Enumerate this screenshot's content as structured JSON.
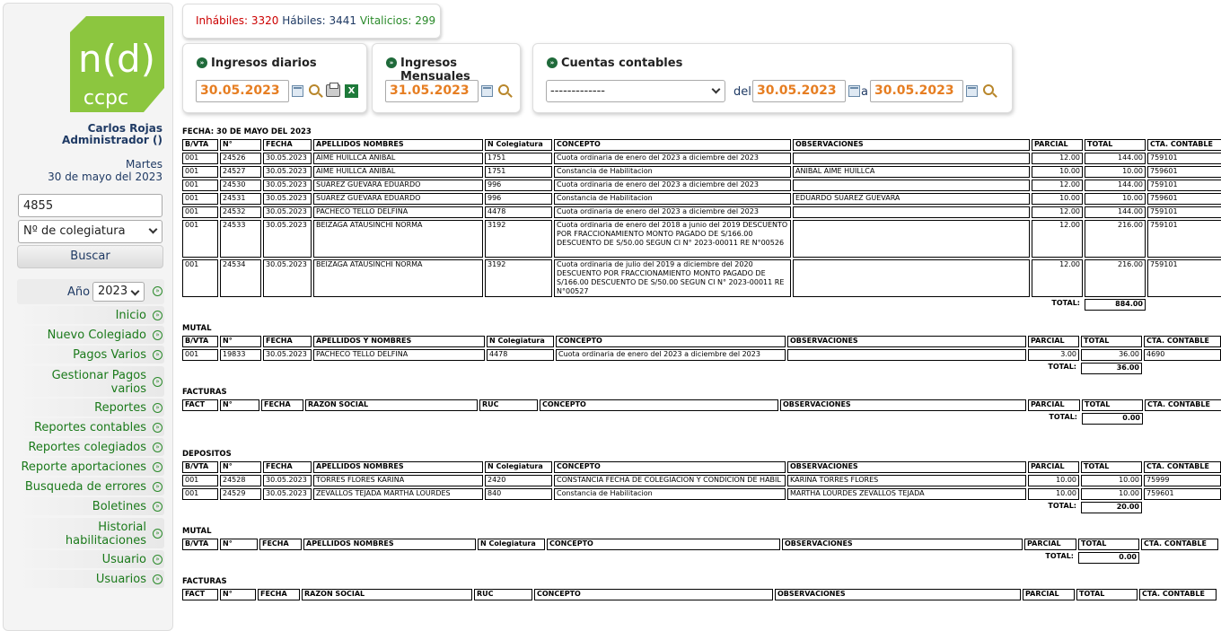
{
  "sidebar": {
    "logo_text_top": "n(d)",
    "logo_text_bottom": "ccpc",
    "user_name": "Carlos Rojas",
    "user_role": "Administrador ()",
    "weekday": "Martes",
    "date": "30 de mayo del 2023",
    "search_value": "4855",
    "search_type": "Nº de colegiatura",
    "search_button": "Buscar",
    "year_label": "Año",
    "year_value": "2023",
    "menu": [
      "Inicio",
      "Nuevo Colegiado",
      "Pagos Varios",
      "Gestionar Pagos varios",
      "Reportes",
      "Reportes contables",
      "Reportes colegiados",
      "Reporte aportaciones",
      "Busqueda de errores",
      "Boletines",
      "Historial habilitaciones",
      "Usuario",
      "Usuarios"
    ]
  },
  "counts": {
    "inhabiles_label": "Inhábiles:",
    "inhabiles": "3320",
    "habiles_label": "Hábiles:",
    "habiles": "3441",
    "vitalicios_label": "Vitalicios:",
    "vitalicios": "299"
  },
  "panels": {
    "diarios_title": "Ingresos diarios",
    "diarios_date": "30.05.2023",
    "mensuales_title": "Ingresos Mensuales",
    "mensuales_date": "31.05.2023",
    "cuentas_title": "Cuentas contables",
    "cuentas_select": "-------------",
    "del_label": "del:",
    "del_date": "30.05.2023",
    "a_label": "a",
    "a_date": "30.05.2023"
  },
  "report": {
    "fecha_title": "FECHA: 30 DE MAYO DEL 2023",
    "main_headers": [
      "B/VTA",
      "N°",
      "FECHA",
      "APELLIDOS NOMBRES",
      "N Colegiatura",
      "CONCEPTO",
      "OBSERVACIONES",
      "PARCIAL",
      "TOTAL",
      "CTA. CONTABLE"
    ],
    "main_rows": [
      [
        "001",
        "24526",
        "30.05.2023",
        "AIME HUILLCA ANIBAL",
        "1751",
        "Cuota ordinaria de enero del 2023 a diciembre del 2023",
        "",
        "12.00",
        "144.00",
        "759101"
      ],
      [
        "001",
        "24527",
        "30.05.2023",
        "AIME HUILLCA ANIBAL",
        "1751",
        "Constancia de Habilitacion",
        "ANIBAL AIME HUILLCA",
        "10.00",
        "10.00",
        "759601"
      ],
      [
        "001",
        "24530",
        "30.05.2023",
        "SUAREZ GUEVARA EDUARDO",
        "996",
        "Cuota ordinaria de enero del 2023 a diciembre del 2023",
        "",
        "12.00",
        "144.00",
        "759101"
      ],
      [
        "001",
        "24531",
        "30.05.2023",
        "SUAREZ GUEVARA EDUARDO",
        "996",
        "Constancia de Habilitacion",
        "EDUARDO SUAREZ GUEVARA",
        "10.00",
        "10.00",
        "759601"
      ],
      [
        "001",
        "24532",
        "30.05.2023",
        "PACHECO TELLO DELFINA",
        "4478",
        "Cuota ordinaria de enero del 2023 a diciembre del 2023",
        "",
        "12.00",
        "144.00",
        "759101"
      ],
      [
        "001",
        "24533",
        "30.05.2023",
        "BEIZAGA ATAUSINCHI NORMA",
        "3192",
        "Cuota ordinaria de enero del 2018 a junio del 2019 DESCUENTO POR FRACCIONAMIENTO MONTO PAGADO DE S/166.00 DESCUENTO DE S/50.00 SEGUN CI N° 2023-00011 RE N°00526",
        "",
        "12.00",
        "216.00",
        "759101"
      ],
      [
        "001",
        "24534",
        "30.05.2023",
        "BEIZAGA ATAUSINCHI NORMA",
        "3192",
        "Cuota ordinaria de julio del 2019 a diciembre del 2020 DESCUENTO POR FRACCIONAMIENTO MONTO PAGADO DE S/166.00 DESCUENTO DE S/50.00 SEGUN CI N° 2023-00011 RE N°00527",
        "",
        "12.00",
        "216.00",
        "759101"
      ]
    ],
    "total_label": "TOTAL:",
    "main_total": "884.00",
    "mutal_title": "MUTAL",
    "mutal_headers": [
      "B/VTA",
      "N°",
      "FECHA",
      "APELLIDOS Y NOMBRES",
      "N Colegiatura",
      "CONCEPTO",
      "OBSERVACIONES",
      "PARCIAL",
      "TOTAL",
      "CTA. CONTABLE"
    ],
    "mutal_rows": [
      [
        "001",
        "19833",
        "30.05.2023",
        "PACHECO TELLO DELFINA",
        "4478",
        "Cuota ordinaria de enero del 2023 a diciembre del 2023",
        "",
        "3.00",
        "36.00",
        "4690"
      ]
    ],
    "mutal_total": "36.00",
    "facturas_title": "FACTURAS",
    "facturas_headers": [
      "FACT",
      "N°",
      "FECHA",
      "RAZON SOCIAL",
      "RUC",
      "CONCEPTO",
      "OBSERVACIONES",
      "PARCIAL",
      "TOTAL",
      "CTA. CONTABLE"
    ],
    "facturas_total": "0.00",
    "depositos_title": "DEPOSITOS",
    "depositos_headers": [
      "B/VTA",
      "N°",
      "FECHA",
      "APELLIDOS NOMBRES",
      "N Colegiatura",
      "CONCEPTO",
      "OBSERVACIONES",
      "PARCIAL",
      "TOTAL",
      "CTA. CONTABLE"
    ],
    "depositos_rows": [
      [
        "001",
        "24528",
        "30.05.2023",
        "TORRES FLORES KARINA",
        "2420",
        "CONSTANCIA FECHA DE COLEGIACION Y CONDICION DE HABIL",
        "KARINA TORRES FLORES",
        "10.00",
        "10.00",
        "75999"
      ],
      [
        "001",
        "24529",
        "30.05.2023",
        "ZEVALLOS TEJADA MARTHA LOURDES",
        "840",
        "Constancia de Habilitacion",
        "MARTHA LOURDES ZEVALLOS TEJADA",
        "10.00",
        "10.00",
        "759601"
      ]
    ],
    "depositos_total": "20.00",
    "mutal2_title": "MUTAL",
    "mutal2_headers": [
      "B/VTA",
      "N°",
      "FECHA",
      "APELLIDOS NOMBRES",
      "N Colegiatura",
      "CONCEPTO",
      "OBSERVACIONES",
      "PARCIAL",
      "TOTAL",
      "CTA. CONTABLE"
    ],
    "mutal2_total": "0.00",
    "facturas2_title": "FACTURAS",
    "facturas2_headers": [
      "FACT",
      "N°",
      "FECHA",
      "RAZON SOCIAL",
      "RUC",
      "CONCEPTO",
      "OBSERVACIONES",
      "PARCIAL",
      "TOTAL",
      "CTA. CONTABLE"
    ]
  }
}
